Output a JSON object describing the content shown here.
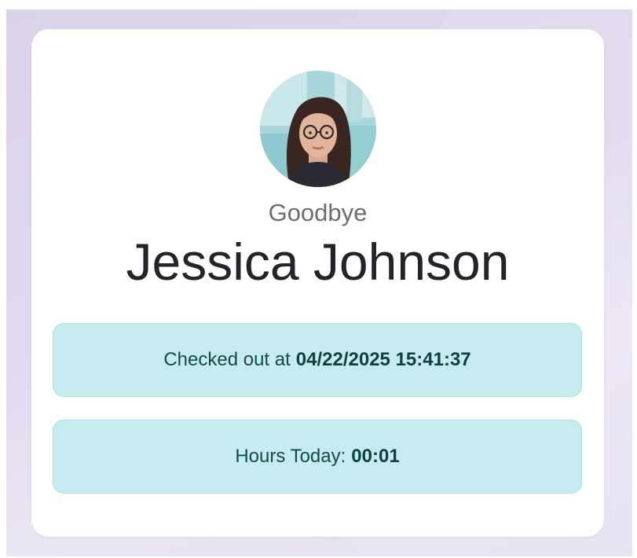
{
  "user": {
    "greeting": "Goodbye",
    "name": "Jessica Johnson",
    "avatar_icon": "user-photo"
  },
  "checkout": {
    "label": "Checked out at",
    "value": "04/22/2025 15:41:37"
  },
  "hours": {
    "label": "Hours Today:",
    "value": "00:01"
  },
  "colors": {
    "background": "#dcd3ea",
    "card": "#ffffff",
    "info_box": "#c7ecf0",
    "info_border": "#a8e0e7",
    "info_text": "#124a52",
    "name_text": "#212529",
    "greeting_text": "#6b6f73"
  }
}
